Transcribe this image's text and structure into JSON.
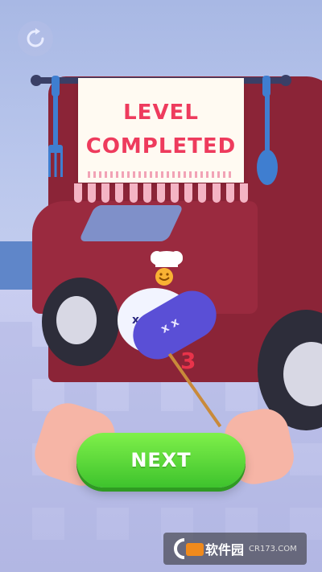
{
  "hud": {
    "restart_icon": "restart-icon"
  },
  "banner": {
    "line1": "LEVEL",
    "line2": "COMPLETED",
    "title_color": "#ee3b5d"
  },
  "counter": {
    "value": "3",
    "color": "#e8334a"
  },
  "next_button": {
    "label": "NEXT",
    "color": "#3ec32d"
  },
  "watermark": {
    "brand": "软件园",
    "url": "CR173.COM"
  }
}
